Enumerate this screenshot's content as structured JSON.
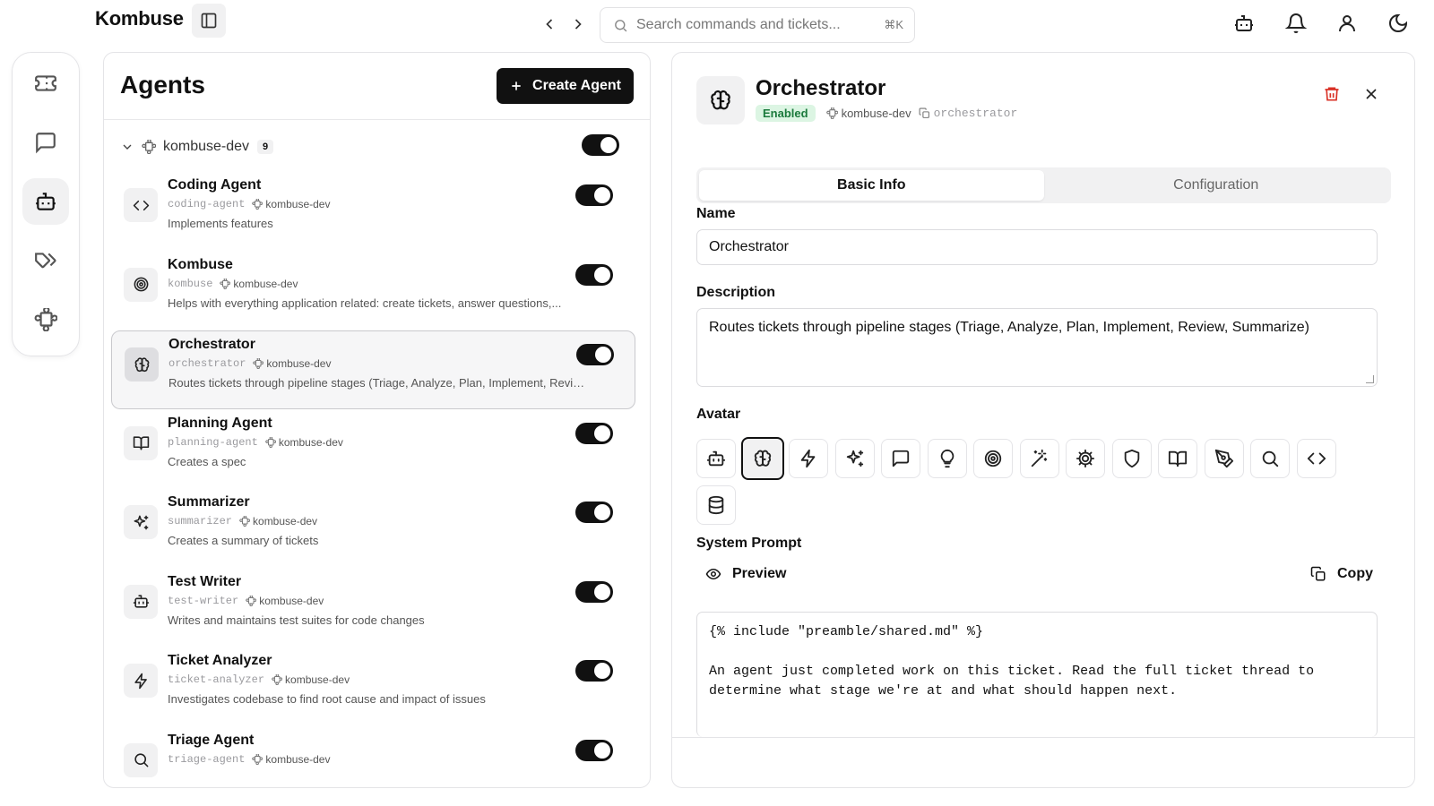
{
  "app": {
    "title": "Kombuse"
  },
  "search": {
    "placeholder": "Search commands and tickets...",
    "shortcut": "⌘K"
  },
  "topbar_icons": [
    "bot-icon",
    "bell-icon",
    "user-icon",
    "moon-icon"
  ],
  "rail": {
    "items": [
      {
        "name": "tickets",
        "icon": "ticket-icon",
        "active": false
      },
      {
        "name": "chats",
        "icon": "chat-icon",
        "active": false
      },
      {
        "name": "agents",
        "icon": "bot-icon",
        "active": true
      },
      {
        "name": "labels",
        "icon": "tags-icon",
        "active": false
      },
      {
        "name": "plugins",
        "icon": "puzzle-icon",
        "active": false
      }
    ]
  },
  "agents_panel": {
    "title": "Agents",
    "create_label": "Create Agent",
    "group": {
      "name": "kombuse-dev",
      "count": "9",
      "enabled": true
    },
    "agents": [
      {
        "name": "Coding Agent",
        "slug": "coding-agent",
        "project": "kombuse-dev",
        "description": "Implements features",
        "icon": "code-icon",
        "enabled": true,
        "selected": false
      },
      {
        "name": "Kombuse",
        "slug": "kombuse",
        "project": "kombuse-dev",
        "description": "Helps with everything application related: create tickets, answer questions,...",
        "icon": "target-icon",
        "enabled": true,
        "selected": false
      },
      {
        "name": "Orchestrator",
        "slug": "orchestrator",
        "project": "kombuse-dev",
        "description": "Routes tickets through pipeline stages (Triage, Analyze, Plan, Implement, Review,...",
        "icon": "brain-icon",
        "enabled": true,
        "selected": true
      },
      {
        "name": "Planning Agent",
        "slug": "planning-agent",
        "project": "kombuse-dev",
        "description": "Creates a spec",
        "icon": "book-icon",
        "enabled": true,
        "selected": false
      },
      {
        "name": "Summarizer",
        "slug": "summarizer",
        "project": "kombuse-dev",
        "description": "Creates a summary of tickets",
        "icon": "sparkles-icon",
        "enabled": true,
        "selected": false
      },
      {
        "name": "Test Writer",
        "slug": "test-writer",
        "project": "kombuse-dev",
        "description": "Writes and maintains test suites for code changes",
        "icon": "bot-icon",
        "enabled": true,
        "selected": false
      },
      {
        "name": "Ticket Analyzer",
        "slug": "ticket-analyzer",
        "project": "kombuse-dev",
        "description": "Investigates codebase to find root cause and impact of issues",
        "icon": "zap-icon",
        "enabled": true,
        "selected": false
      },
      {
        "name": "Triage Agent",
        "slug": "triage-agent",
        "project": "kombuse-dev",
        "description": "",
        "icon": "search-icon",
        "enabled": true,
        "selected": false
      }
    ]
  },
  "detail": {
    "title": "Orchestrator",
    "status": "Enabled",
    "project": "kombuse-dev",
    "slug": "orchestrator",
    "tabs": [
      {
        "label": "Basic Info",
        "active": true
      },
      {
        "label": "Configuration",
        "active": false
      }
    ],
    "name_label": "Name",
    "name_value": "Orchestrator",
    "description_label": "Description",
    "description_value": "Routes tickets through pipeline stages (Triage, Analyze, Plan, Implement, Review, Summarize)",
    "avatar_label": "Avatar",
    "avatar_options": [
      "bot-icon",
      "brain-icon",
      "zap-icon",
      "sparkles-icon",
      "chat-icon",
      "lightbulb-icon",
      "target-icon",
      "wand-icon",
      "cog-icon",
      "shield-icon",
      "book-icon",
      "pen-icon",
      "search-icon",
      "code-icon",
      "database-icon"
    ],
    "avatar_selected": "brain-icon",
    "system_prompt_label": "System Prompt",
    "preview_label": "Preview",
    "copy_label": "Copy",
    "system_prompt": "{% include \"preamble/shared.md\" %}\n\nAn agent just completed work on this ticket. Read the full ticket thread to\ndetermine what stage we're at and what should happen next."
  },
  "colors": {
    "accent": "#111111",
    "enabled_bg": "#dcf5e3",
    "enabled_text": "#1b7a3c",
    "danger": "#d93025"
  }
}
